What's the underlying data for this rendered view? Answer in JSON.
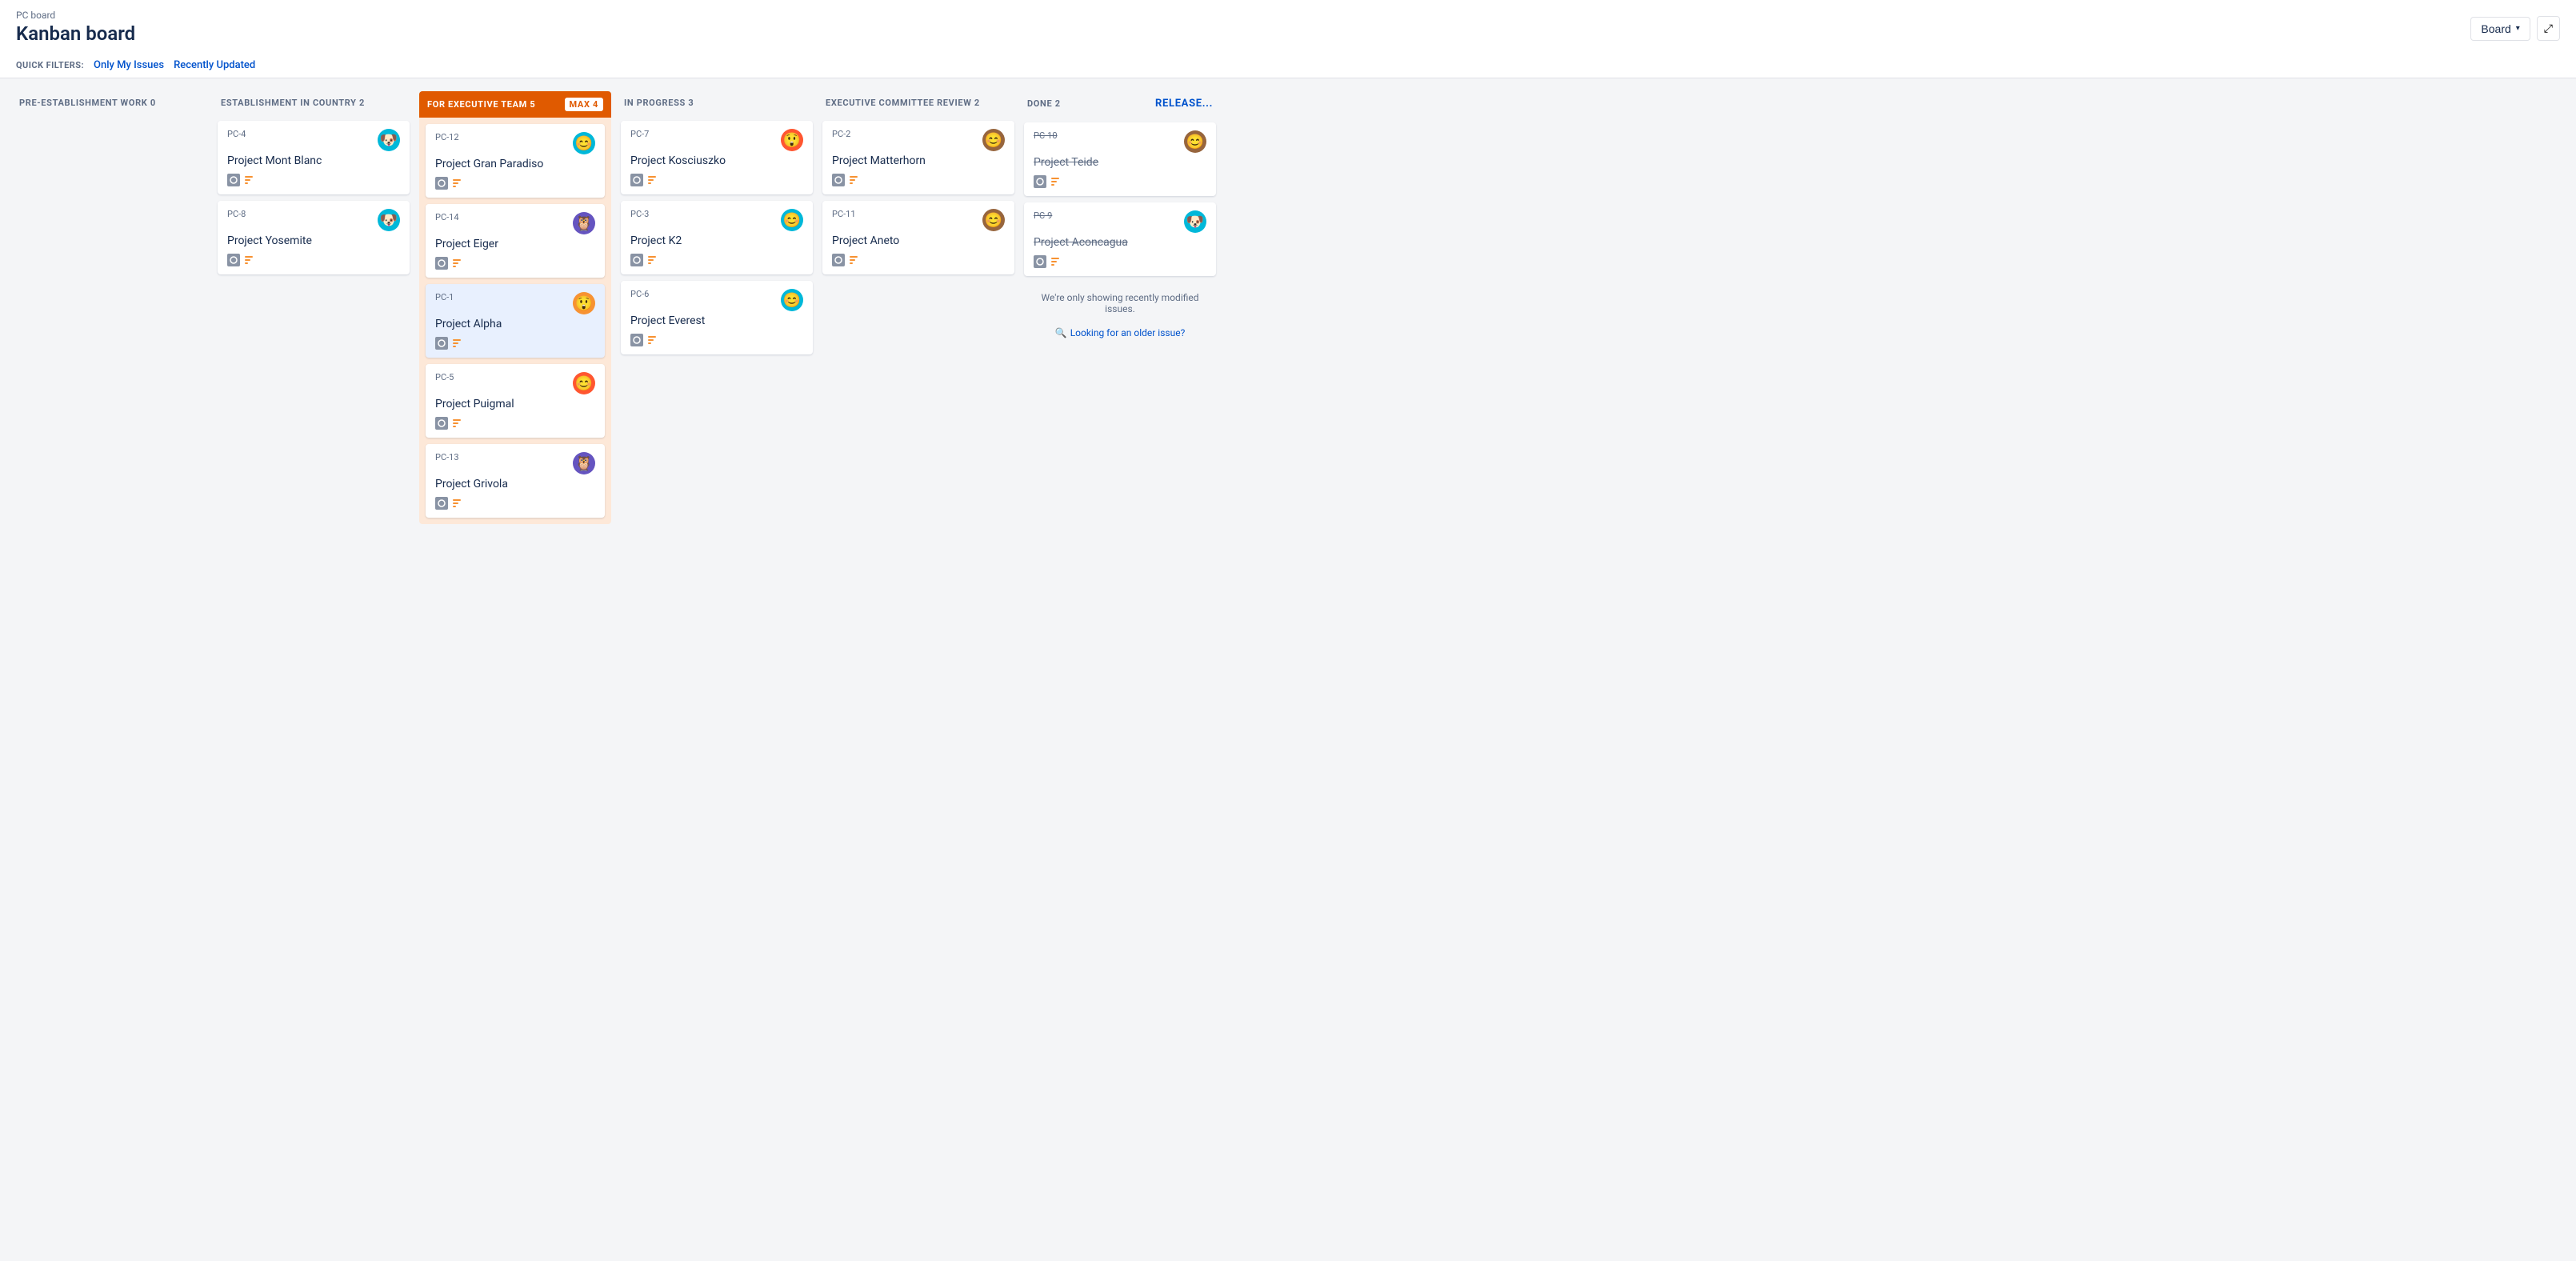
{
  "breadcrumb": "PC board",
  "pageTitle": "Kanban board",
  "headerBtn": "Board",
  "quickFilters": {
    "label": "QUICK FILTERS:",
    "filters": [
      "Only My Issues",
      "Recently Updated"
    ]
  },
  "columns": [
    {
      "id": "pre-establishment",
      "title": "PRE-ESTABLISHMENT WORK",
      "count": 0,
      "cards": []
    },
    {
      "id": "establishment",
      "title": "ESTABLISHMENT IN COUNTRY",
      "count": 2,
      "cards": [
        {
          "id": "PC-4",
          "title": "Project Mont Blanc",
          "avatar": "🐶",
          "avatarClass": "av-teal"
        },
        {
          "id": "PC-8",
          "title": "Project Yosemite",
          "avatar": "🐶",
          "avatarClass": "av-teal"
        }
      ]
    },
    {
      "id": "for-executive",
      "title": "FOR EXECUTIVE TEAM",
      "count": 5,
      "maxLabel": "MAX 4",
      "isOrange": true,
      "cards": [
        {
          "id": "PC-12",
          "title": "Project Gran Paradiso",
          "avatar": "😊",
          "avatarClass": "av-teal"
        },
        {
          "id": "PC-14",
          "title": "Project Eiger",
          "avatar": "🦉",
          "avatarClass": "av-purple"
        },
        {
          "id": "PC-1",
          "title": "Project Alpha",
          "avatar": "😲",
          "avatarClass": "av-yellow",
          "highlighted": true
        },
        {
          "id": "PC-5",
          "title": "Project Puigmal",
          "avatar": "😊",
          "avatarClass": "av-orange"
        },
        {
          "id": "PC-13",
          "title": "Project Grivola",
          "avatar": "🦉",
          "avatarClass": "av-purple"
        }
      ]
    },
    {
      "id": "in-progress",
      "title": "IN PROGRESS",
      "count": 3,
      "cards": [
        {
          "id": "PC-7",
          "title": "Project Kosciuszko",
          "avatar": "😲",
          "avatarClass": "av-orange"
        },
        {
          "id": "PC-3",
          "title": "Project K2",
          "avatar": "😊",
          "avatarClass": "av-teal"
        },
        {
          "id": "PC-6",
          "title": "Project Everest",
          "avatar": "😊",
          "avatarClass": "av-teal"
        }
      ]
    },
    {
      "id": "executive-review",
      "title": "EXECUTIVE COMMITTEE REVIEW",
      "count": 2,
      "cards": [
        {
          "id": "PC-2",
          "title": "Project Matterhorn",
          "avatar": "😊",
          "avatarClass": "av-brown"
        },
        {
          "id": "PC-11",
          "title": "Project Aneto",
          "avatar": "😊",
          "avatarClass": "av-brown"
        }
      ]
    },
    {
      "id": "done",
      "title": "DONE",
      "count": 2,
      "releaseLink": "Release...",
      "note": "We're only showing recently modified issues.",
      "noteLink": "Looking for an older issue?",
      "cards": [
        {
          "id": "PC-10",
          "title": "Project Teide",
          "avatar": "😊",
          "avatarClass": "av-brown",
          "strikethrough": true
        },
        {
          "id": "PC-9",
          "title": "Project Aconcagua",
          "avatar": "🐶",
          "avatarClass": "av-teal",
          "strikethrough": true
        }
      ]
    }
  ]
}
